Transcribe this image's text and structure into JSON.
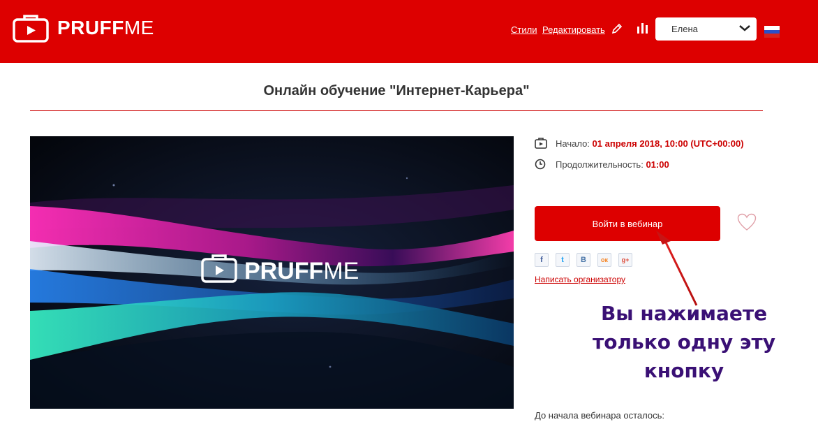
{
  "header": {
    "logo_bold": "PRUFF",
    "logo_light": "ME",
    "styles_link": "Стили",
    "edit_link": "Редактировать",
    "user_name": "Елена",
    "brand_color": "#dd0000",
    "icons": [
      "pencil-icon",
      "stats-icon",
      "chevron-down-icon",
      "flag-icon"
    ]
  },
  "page": {
    "title": "Онлайн обучение \"Интернет-Карьера\""
  },
  "banner": {
    "logo_bold": "PRUFF",
    "logo_light": "ME"
  },
  "event": {
    "start_label": "Начало:",
    "start_value": "01 апреля 2018, 10:00 (UTC+00:00)",
    "duration_label": "Продолжительность:",
    "duration_value": "01:00",
    "join_button": "Войти в вебинар",
    "share": [
      {
        "name": "facebook",
        "glyph": "f",
        "color": "#3b5998"
      },
      {
        "name": "twitter",
        "glyph": "t",
        "color": "#1da1f2"
      },
      {
        "name": "vk",
        "glyph": "В",
        "color": "#4a76a8"
      },
      {
        "name": "odnoklassniki",
        "glyph": "ок",
        "color": "#f58220"
      },
      {
        "name": "google-plus",
        "glyph": "g+",
        "color": "#dd4b39"
      }
    ],
    "contact_link": "Написать организатору",
    "countdown_label": "До начала вебинара осталось:"
  },
  "annotation": {
    "line1": "Вы нажимаете",
    "line2": "только одну эту",
    "line3": "кнопку",
    "color": "#3a1075"
  }
}
